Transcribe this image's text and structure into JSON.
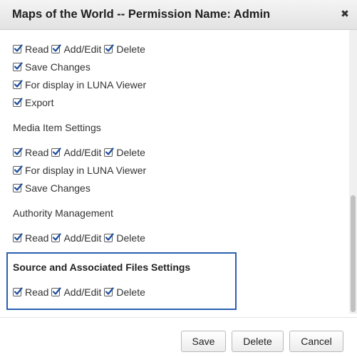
{
  "dialog": {
    "title": "Maps of the World -- Permission Name: Admin",
    "close_icon": "close-icon"
  },
  "permissions": {
    "group1": {
      "row1": [
        "Read",
        "Add/Edit",
        "Delete"
      ],
      "save_changes": "Save Changes",
      "luna_viewer": "For display in LUNA Viewer",
      "export": "Export"
    },
    "media_item": {
      "heading": "Media Item Settings",
      "row1": [
        "Read",
        "Add/Edit",
        "Delete"
      ],
      "luna_viewer": "For display in LUNA Viewer",
      "save_changes": "Save Changes"
    },
    "authority": {
      "heading": "Authority Management",
      "row1": [
        "Read",
        "Add/Edit",
        "Delete"
      ]
    },
    "source_files": {
      "heading": "Source and Associated Files Settings",
      "row1": [
        "Read",
        "Add/Edit",
        "Delete"
      ]
    }
  },
  "footer": {
    "save_label": "Save",
    "delete_label": "Delete",
    "cancel_label": "Cancel"
  },
  "colors": {
    "highlight_border": "#2b5fb0",
    "checkbox_check": "#1a4d9c"
  }
}
